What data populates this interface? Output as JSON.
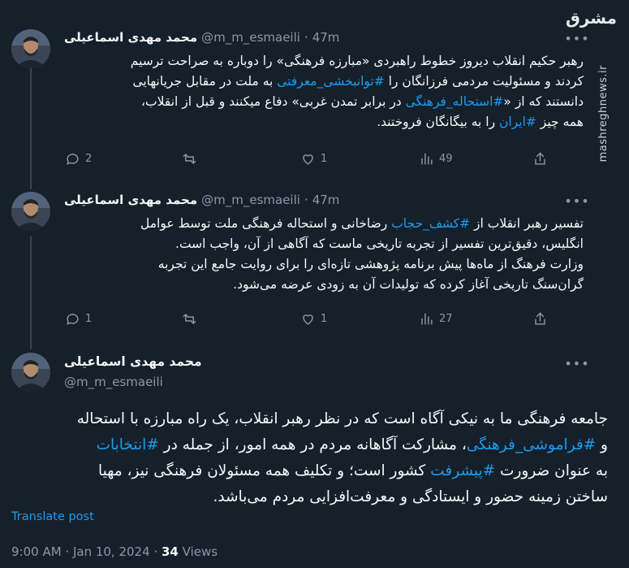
{
  "watermark": {
    "logo_text": "مشرق",
    "site": "mashreghnews.ir"
  },
  "tweets": [
    {
      "author_name": "محمد مهدی اسماعیلی",
      "handle": "@m_m_esmaeili",
      "separator": "·",
      "time": "47m",
      "lines": [
        "رهبر حکیم انقلاب دیروز خطوط راهبردی «مبارزه فرهنگی» را دوباره به صراحت ترسیم",
        "کردند و مسئولیت مردمی فرزانگان را #توانبخشی_معرفتی به ملت در مقابل جریانهایی",
        "دانستند که از «#استحاله_فرهنگی در برابر تمدن غربی» دفاع میکنند و قبل از انقلاب،",
        "همه چیز #ایران را به بیگانگان فروختند."
      ],
      "replies": "2",
      "retweets": "",
      "likes": "1",
      "views": "49"
    },
    {
      "author_name": "محمد مهدی اسماعیلی",
      "handle": "@m_m_esmaeili",
      "separator": "·",
      "time": "47m",
      "lines": [
        "تفسیر رهبر انقلاب از #کشف_حجاب رضاخانی و استحاله فرهنگی ملت توسط عوامل",
        "انگلیس، دقیق‌ترین تفسیر از تجربه تاریخی ماست که آگاهی از آن، واجب است.",
        "وزارت فرهنگ از ماه‌ها پیش برنامه پژوهشی تازه‌ای را برای روایت جامع این تجربه",
        "گران‌سنگ تاریخی آغاز کرده که تولیدات آن به زودی عرضه می‌شود."
      ],
      "replies": "1",
      "retweets": "",
      "likes": "1",
      "views": "27"
    }
  ],
  "main_tweet": {
    "author_name": "محمد مهدی اسماعیلی",
    "handle": "@m_m_esmaeili",
    "lines": [
      "جامعه فرهنگی ما به نیکی آگاه است که در نظر رهبر انقلاب، یک راه مبارزه با استحاله",
      "و #فراموشی_فرهنگی، مشارکت آگاهانه مردم در همه امور، از جمله در #انتخابات",
      "به عنوان ضرورت #پیشرفت کشور است؛ و تکلیف همه مسئولان فرهنگی نیز، مهیا",
      "ساختن زمینه حضور و ایستادگی و معرفت‌افزایی مردم می‌باشد."
    ],
    "translate_label": "Translate post",
    "timestamp": "9:00 AM · Jan 10, 2024",
    "meta_dot": "·",
    "views_count": "34",
    "views_label": "Views"
  },
  "colors": {
    "background": "#15202b",
    "text": "#f7f9f9",
    "muted": "#8b98a5",
    "link": "#1d9bf0"
  },
  "icons": [
    "more-icon",
    "reply-icon",
    "retweet-icon",
    "like-icon",
    "views-icon",
    "share-icon"
  ]
}
